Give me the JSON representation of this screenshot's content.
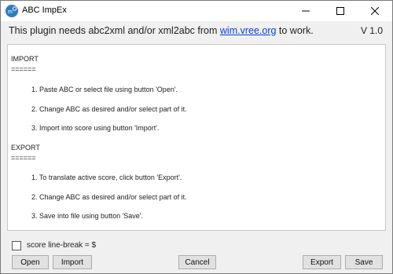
{
  "window": {
    "title": "ABC ImpEx",
    "app_icon": "abc-impex-app-icon"
  },
  "header": {
    "text_before": "This plugin needs abc2xml and/or xml2abc from ",
    "link": "wim.vree.org",
    "text_after": " to work.",
    "version": "V 1.0"
  },
  "content": {
    "lines": [
      "IMPORT",
      "======",
      "1. Paste ABC or select file using button 'Open'.",
      "2. Change ABC as desired and/or select part of it.",
      "3. Import into score using button 'Import'.",
      "EXPORT",
      "======",
      "1. To translate active score, click button 'Export'.",
      "2. Change ABC as desired and/or select part of it.",
      "3. Save into file using button 'Save'."
    ]
  },
  "options": {
    "line_break_label": "score line-break = $",
    "line_break_checked": false
  },
  "buttons": {
    "open": "Open",
    "import": "Import",
    "cancel": "Cancel",
    "export": "Export",
    "save": "Save"
  },
  "colors": {
    "link": "#0a3fd6",
    "app_icon": "#2f7dbf"
  }
}
